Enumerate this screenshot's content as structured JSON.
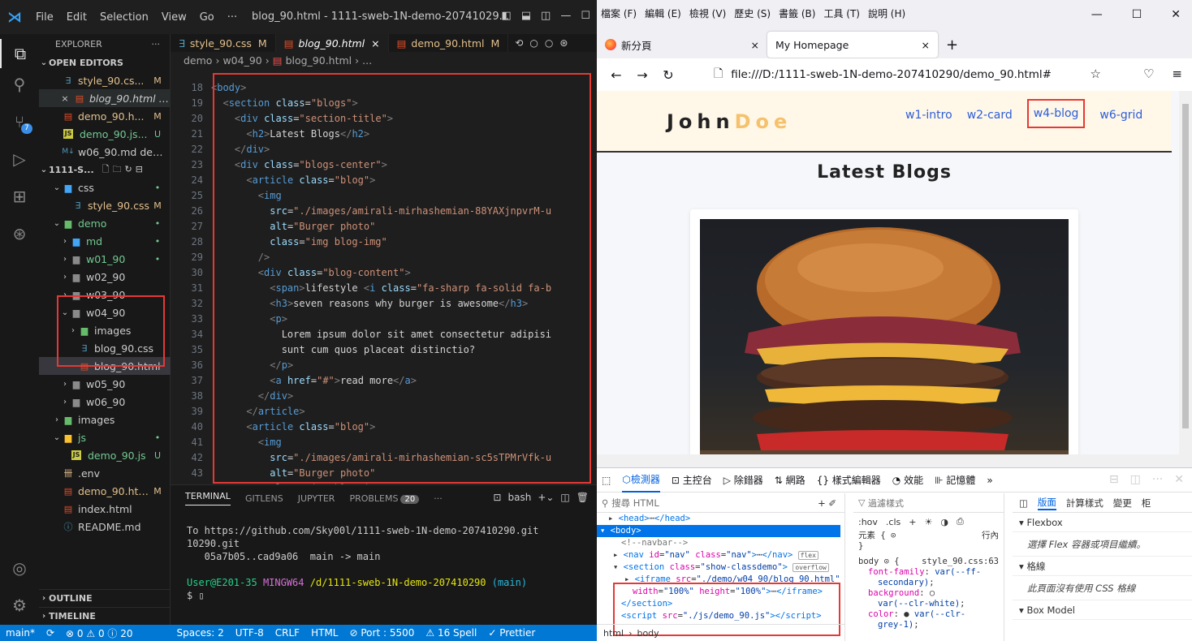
{
  "vscode": {
    "menu": [
      "File",
      "Edit",
      "Selection",
      "View",
      "Go",
      "···"
    ],
    "title": "blog_90.html - 1111-sweb-1N-demo-20741029...",
    "explorer_label": "EXPLORER",
    "open_editors_label": "OPEN EDITORS",
    "open_editors": [
      {
        "label": "style_90.cs...",
        "status": "M"
      },
      {
        "label": "blog_90.html de...",
        "status": ""
      },
      {
        "label": "demo_90.h...",
        "status": "M"
      },
      {
        "label": "demo_90.js...",
        "status": "U"
      },
      {
        "label": "w06_90.md dem...",
        "status": ""
      }
    ],
    "workspace_label": "1111-S...",
    "tree": [
      {
        "label": "css",
        "status": "•"
      },
      {
        "label": "style_90.css",
        "status": "M"
      },
      {
        "label": "demo",
        "status": "•"
      },
      {
        "label": "md",
        "status": "•"
      },
      {
        "label": "w01_90",
        "status": "•"
      },
      {
        "label": "w02_90",
        "status": ""
      },
      {
        "label": "w03_90",
        "status": ""
      },
      {
        "label": "w04_90",
        "status": ""
      },
      {
        "label": "images",
        "status": ""
      },
      {
        "label": "blog_90.css",
        "status": ""
      },
      {
        "label": "blog_90.html",
        "status": ""
      },
      {
        "label": "w05_90",
        "status": ""
      },
      {
        "label": "w06_90",
        "status": ""
      },
      {
        "label": "images",
        "status": ""
      },
      {
        "label": "js",
        "status": "•"
      },
      {
        "label": "demo_90.js",
        "status": "U"
      },
      {
        "label": ".env",
        "status": ""
      },
      {
        "label": "demo_90.html",
        "status": "M"
      },
      {
        "label": "index.html",
        "status": ""
      },
      {
        "label": "README.md",
        "status": ""
      }
    ],
    "outline_label": "OUTLINE",
    "timeline_label": "TIMELINE",
    "tabs": [
      {
        "label": "style_90.css",
        "mod": "M"
      },
      {
        "label": "blog_90.html",
        "mod": "×"
      },
      {
        "label": "demo_90.html",
        "mod": "M"
      }
    ],
    "breadcrumb": [
      "demo",
      "w04_90",
      "blog_90.html",
      "..."
    ],
    "code_lines": [
      {
        "n": "18",
        "t": "<body>"
      },
      {
        "n": "19",
        "t": "  <section class=\"blogs\">"
      },
      {
        "n": "20",
        "t": "    <div class=\"section-title\">"
      },
      {
        "n": "21",
        "t": "      <h2>Latest Blogs</h2>"
      },
      {
        "n": "22",
        "t": "    </div>"
      },
      {
        "n": "23",
        "t": "    <div class=\"blogs-center\">"
      },
      {
        "n": "24",
        "t": "      <article class=\"blog\">"
      },
      {
        "n": "25",
        "t": "        <img"
      },
      {
        "n": "26",
        "t": "          src=\"./images/amirali-mirhashemian-88YAXjnpvrM-u"
      },
      {
        "n": "27",
        "t": "          alt=\"Burger photo\""
      },
      {
        "n": "28",
        "t": "          class=\"img blog-img\""
      },
      {
        "n": "29",
        "t": "        />"
      },
      {
        "n": "30",
        "t": "        <div class=\"blog-content\">"
      },
      {
        "n": "31",
        "t": "          <span>lifestyle <i class=\"fa-sharp fa-solid fa-b"
      },
      {
        "n": "32",
        "t": "          <h3>seven reasons why burger is awesome</h3>"
      },
      {
        "n": "33",
        "t": "          <p>"
      },
      {
        "n": "34",
        "t": "            Lorem ipsum dolor sit amet consectetur adipisi"
      },
      {
        "n": "35",
        "t": "            sunt cum quos placeat distinctio?"
      },
      {
        "n": "36",
        "t": "          </p>"
      },
      {
        "n": "37",
        "t": "          <a href=\"#\">read more</a>"
      },
      {
        "n": "38",
        "t": "        </div>"
      },
      {
        "n": "39",
        "t": "      </article>"
      },
      {
        "n": "40",
        "t": "      <article class=\"blog\">"
      },
      {
        "n": "41",
        "t": "        <img"
      },
      {
        "n": "42",
        "t": "          src=\"./images/amirali-mirhashemian-sc5sTPMrVfk-u"
      },
      {
        "n": "43",
        "t": "          alt=\"Burger photo\""
      },
      {
        "n": "44",
        "t": "          class=\"img blog-img\""
      },
      {
        "n": "45",
        "t": ""
      }
    ],
    "panel_tabs": [
      "TERMINAL",
      "GITLENS",
      "JUPYTER",
      "PROBLEMS",
      "···"
    ],
    "problems_count": "20",
    "shell": "bash",
    "terminal": {
      "line1": "To https://github.com/Sky00l/1111-sweb-1N-demo-207410290.git",
      "line2": "   05a7b05..cad9a06  main -> main",
      "prompt_user": "User@E201-35",
      "prompt_shell": "MINGW64",
      "prompt_path": "/d/1111-sweb-1N-demo-207410290",
      "prompt_branch": "(main)",
      "prompt_symbol": "$"
    },
    "status": [
      "main*",
      "⟳",
      "⊗ 0 ⚠ 0 ⓘ 20",
      "Spaces: 2",
      "UTF-8",
      "CRLF",
      "HTML",
      "⊘ Port : 5500",
      "⚠ 16 Spell",
      "✓ Prettier"
    ]
  },
  "firefox": {
    "menu": [
      "檔案 (F)",
      "編輯 (E)",
      "檢視 (V)",
      "歷史 (S)",
      "書籤 (B)",
      "工具 (T)",
      "說明 (H)"
    ],
    "tabs": [
      {
        "label": "新分頁"
      },
      {
        "label": "My Homepage"
      }
    ],
    "url": "file:///D:/1111-sweb-1N-demo-207410290/demo_90.html#",
    "site": {
      "logo_main": "John",
      "logo_accent": "Doe",
      "nav_links": [
        "w1-intro",
        "w2-card",
        "w4-blog",
        "w6-grid"
      ],
      "heading": "Latest Blogs"
    },
    "devtools": {
      "tabs": [
        "檢測器",
        "主控台",
        "除錯器",
        "網路",
        "樣式編輯器",
        "效能",
        "記憶體",
        "»"
      ],
      "search_placeholder": "搜尋 HTML",
      "rules_filter": "過濾樣式",
      "rules_bar": [
        ":hov",
        ".cls",
        "+"
      ],
      "element_label": "元素 {",
      "inline_label": "行內",
      "body_rule": "body",
      "body_source": "style_90.css:63",
      "layout_tabs": [
        "版面",
        "計算樣式",
        "變更",
        "柜"
      ],
      "flexbox_label": "Flexbox",
      "flexbox_hint": "選擇 Flex 容器或項目繼續。",
      "grid_label": "格線",
      "grid_hint": "此頁面沒有使用 CSS 格線",
      "boxmodel_label": "Box Model",
      "footer": [
        "html",
        "body"
      ]
    }
  }
}
